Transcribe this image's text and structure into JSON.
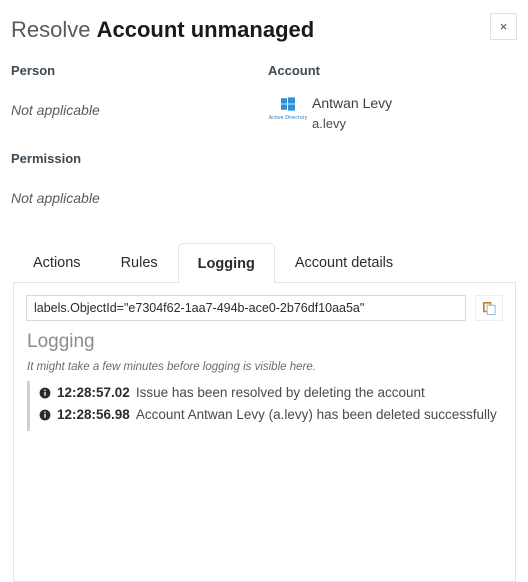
{
  "dialog": {
    "title_prefix": "Resolve",
    "title_main": "Account unmanaged",
    "close_label": "×"
  },
  "person": {
    "label": "Person",
    "value": "Not applicable"
  },
  "account": {
    "label": "Account",
    "icon_name": "active-directory-icon",
    "icon_caption": "Active Directory",
    "name": "Antwan Levy",
    "login": "a.levy"
  },
  "permission": {
    "label": "Permission",
    "value": "Not applicable"
  },
  "tabs": [
    {
      "label": "Actions",
      "active": false
    },
    {
      "label": "Rules",
      "active": false
    },
    {
      "label": "Logging",
      "active": true
    },
    {
      "label": "Account details",
      "active": false
    }
  ],
  "query": {
    "value": "labels.ObjectId=\"e7304f62-1aa7-494b-ace0-2b76df10aa5a\"",
    "placeholder": "",
    "copy_button_name": "copy-icon"
  },
  "logging": {
    "heading": "Logging",
    "note": "It might take a few minutes before logging is visible here.",
    "entries": [
      {
        "icon": "info-icon",
        "time": "12:28:57.02",
        "message": "Issue has been resolved by deleting the account"
      },
      {
        "icon": "info-icon",
        "time": "12:28:56.98",
        "message": "Account Antwan Levy (a.levy) has been deleted successfully"
      }
    ]
  },
  "colors": {
    "accent_blue": "#2f7bbf",
    "border": "#e3e3e3",
    "text_dark": "#1a1a1a",
    "text_muted": "#8c8c8c"
  }
}
